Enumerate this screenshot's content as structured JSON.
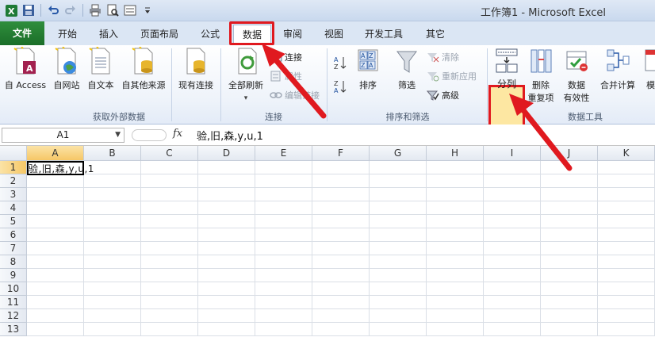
{
  "window": {
    "title": "工作簿1 - Microsoft Excel"
  },
  "tabs": [
    {
      "label": "文件"
    },
    {
      "label": "开始"
    },
    {
      "label": "插入"
    },
    {
      "label": "页面布局"
    },
    {
      "label": "公式"
    },
    {
      "label": "数据"
    },
    {
      "label": "审阅"
    },
    {
      "label": "视图"
    },
    {
      "label": "开发工具"
    },
    {
      "label": "其它"
    }
  ],
  "ribbon": {
    "groups": {
      "external": "获取外部数据",
      "connections": "连接",
      "sortfilter": "排序和筛选",
      "tools": "数据工具"
    },
    "buttons": {
      "access": "自 Access",
      "web": "自网站",
      "text": "自文本",
      "other": "自其他来源",
      "existing": "现有连接",
      "refresh": "全部刷新",
      "connect": "连接",
      "props": "属性",
      "editlinks": "编辑链接",
      "sort": "排序",
      "filter": "筛选",
      "clear": "清除",
      "reapply": "重新应用",
      "advanced": "高级",
      "split": "分列",
      "dedup_1": "删除",
      "dedup_2": "重复项",
      "valid_1": "数据",
      "valid_2": "有效性",
      "consolidate": "合并计算",
      "whatif": "模拟"
    }
  },
  "formula_bar": {
    "name_box": "A1",
    "fx_label": "fx",
    "content": "验,旧,森,y,u,1"
  },
  "sheet": {
    "columns": [
      "A",
      "B",
      "C",
      "D",
      "E",
      "F",
      "G",
      "H",
      "I",
      "J",
      "K"
    ],
    "rows": [
      "1",
      "2",
      "3",
      "4",
      "5",
      "6",
      "7",
      "8",
      "9",
      "10",
      "11",
      "12",
      "13"
    ],
    "a1_value": "验,旧,森,y,u,1"
  },
  "colors": {
    "highlight_red": "#e0191f",
    "file_tab_green": "#2f8e3c",
    "split_highlight": "#fde7a2"
  }
}
